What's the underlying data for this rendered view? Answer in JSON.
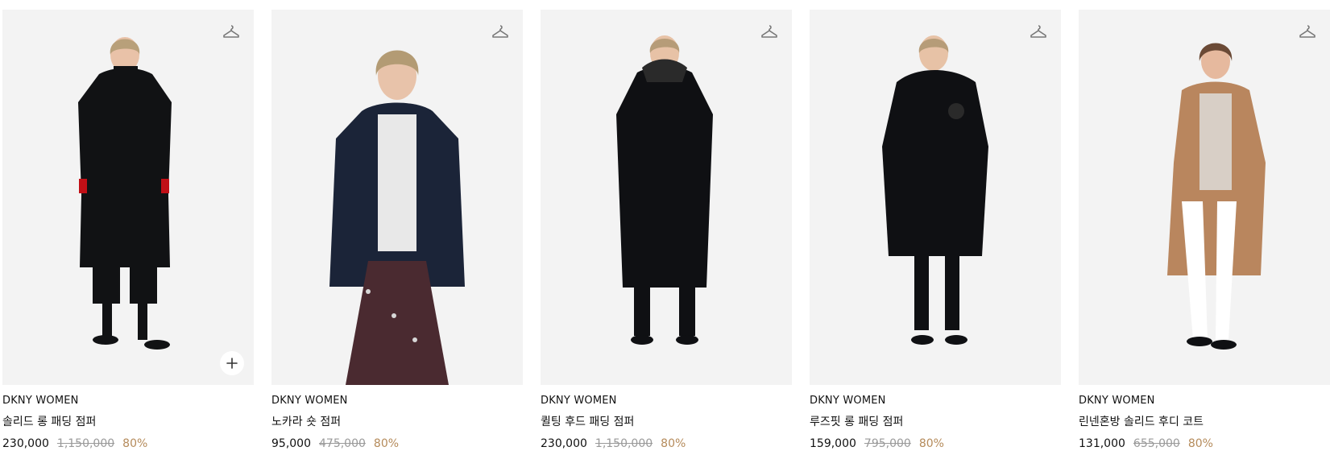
{
  "products": [
    {
      "brand": "DKNY WOMEN",
      "name": "솔리드 롱 패딩 점퍼",
      "sale_price": "230,000",
      "original_price": "1,150,000",
      "discount": "80%",
      "icons": [
        "hanger-icon",
        "plus-icon"
      ],
      "colors": {
        "bg": "#f3f3f3",
        "garment": "#111214",
        "skin": "#e9c2a8",
        "hair": "#b8a07a",
        "accent": "#c10f16"
      }
    },
    {
      "brand": "DKNY WOMEN",
      "name": "노카라 숏 점퍼",
      "sale_price": "95,000",
      "original_price": "475,000",
      "discount": "80%",
      "icons": [
        "hanger-icon"
      ],
      "colors": {
        "bg": "#f3f3f3",
        "garment": "#1b2438",
        "skin": "#e8c3aa",
        "hair": "#b39b74",
        "accent": "#e8e8e8"
      }
    },
    {
      "brand": "DKNY WOMEN",
      "name": "퀼팅 후드 패딩 점퍼",
      "sale_price": "230,000",
      "original_price": "1,150,000",
      "discount": "80%",
      "icons": [
        "hanger-icon"
      ],
      "colors": {
        "bg": "#f3f3f3",
        "garment": "#0f1013",
        "skin": "#e7c2a6",
        "hair": "#b69c78",
        "accent": "#2a2a2a"
      }
    },
    {
      "brand": "DKNY WOMEN",
      "name": "루즈핏 롱 패딩 점퍼",
      "sale_price": "159,000",
      "original_price": "795,000",
      "discount": "80%",
      "icons": [
        "hanger-icon"
      ],
      "colors": {
        "bg": "#f3f3f3",
        "garment": "#0f1013",
        "skin": "#e7c2a6",
        "hair": "#b69c78",
        "accent": "#2a2a2a"
      }
    },
    {
      "brand": "DKNY WOMEN",
      "name": "린넨혼방 솔리드 후디 코트",
      "sale_price": "131,000",
      "original_price": "655,000",
      "discount": "80%",
      "icons": [
        "hanger-icon"
      ],
      "colors": {
        "bg": "#f3f3f3",
        "garment": "#b9865e",
        "skin": "#e6b99e",
        "hair": "#6b4a36",
        "accent": "#ffffff"
      }
    }
  ]
}
